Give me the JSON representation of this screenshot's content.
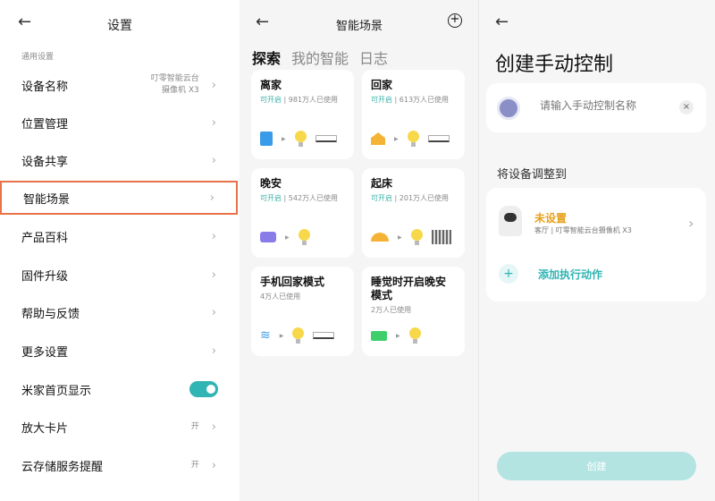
{
  "settings": {
    "title": "设置",
    "section": "通用设置",
    "items": [
      {
        "label": "设备名称",
        "value": "叮零智能云台",
        "value2": "摄像机 X3"
      },
      {
        "label": "位置管理"
      },
      {
        "label": "设备共享"
      },
      {
        "label": "智能场景"
      },
      {
        "label": "产品百科"
      },
      {
        "label": "固件升级"
      },
      {
        "label": "帮助与反馈"
      },
      {
        "label": "更多设置"
      },
      {
        "label": "米家首页显示"
      },
      {
        "label": "放大卡片",
        "value": "开"
      },
      {
        "label": "云存储服务提醒",
        "value": "开"
      }
    ]
  },
  "scenes": {
    "title": "智能场景",
    "tabs": [
      "探索",
      "我的智能",
      "日志"
    ],
    "cards": [
      {
        "title": "离家",
        "status": "可开启",
        "users": "981万人已使用"
      },
      {
        "title": "回家",
        "status": "可开启",
        "users": "613万人已使用"
      },
      {
        "title": "晚安",
        "status": "可开启",
        "users": "542万人已使用"
      },
      {
        "title": "起床",
        "status": "可开启",
        "users": "201万人已使用"
      },
      {
        "title": "手机回家模式",
        "users": "4万人已使用"
      },
      {
        "title": "睡觉时开启晚安模式",
        "users": "2万人已使用"
      }
    ]
  },
  "manual": {
    "title": "创建手动控制",
    "placeholder": "请输入手动控制名称",
    "section": "将设备调整到",
    "device_status": "未设置",
    "room": "客厅",
    "device": "叮零智能云台摄像机 X3",
    "add_action": "添加执行动作",
    "create": "创建"
  },
  "colors": {
    "accent": "#30b4b4",
    "highlight": "#e8734a",
    "warning": "#e6a019"
  }
}
